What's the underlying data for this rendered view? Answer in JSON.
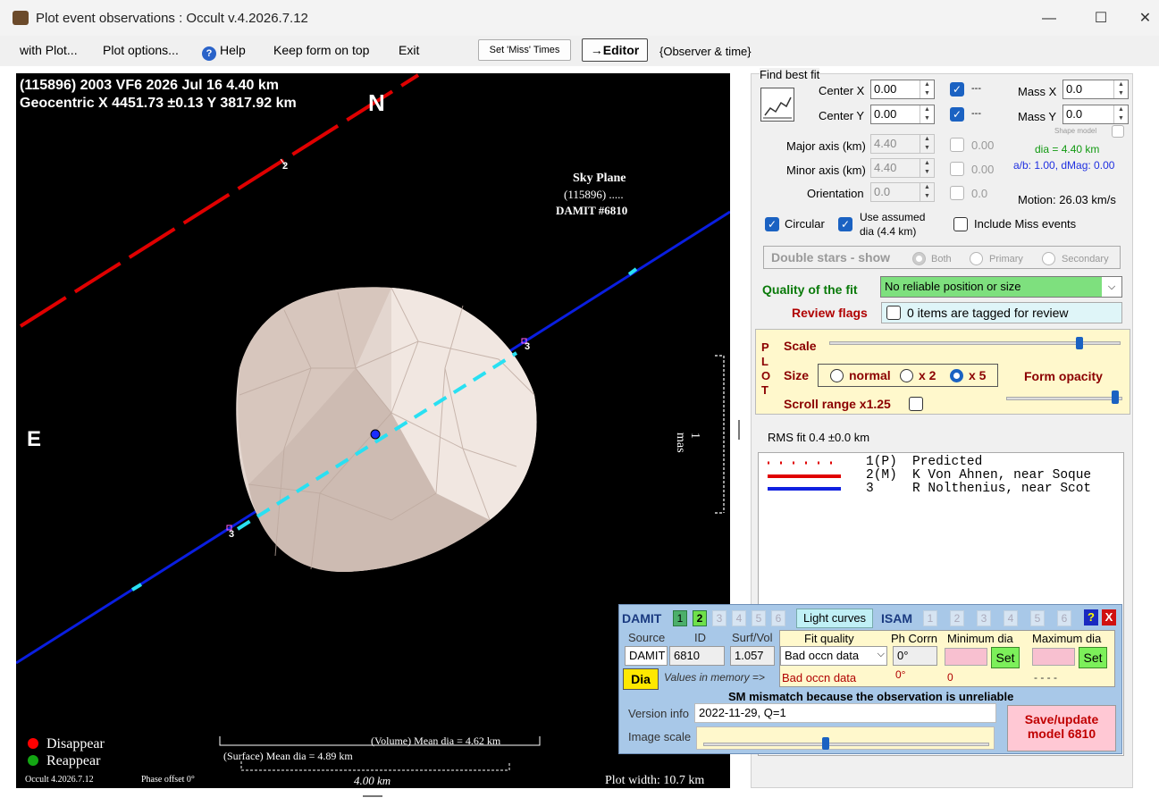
{
  "window": {
    "title": "Plot event observations : Occult v.4.2026.7.12",
    "minimize": "—",
    "maximize": "☐",
    "close": "✕"
  },
  "menu": {
    "with_plot": "with Plot...",
    "plot_options": "Plot options...",
    "help": "Help",
    "keep_on_top": "Keep form on top",
    "exit": "Exit",
    "set_miss_times": "Set 'Miss' Times",
    "editor": "→Editor",
    "observer_time": "{Observer & time}"
  },
  "plot": {
    "header_line1": "(115896) 2003 VF6  2026 Jul 16   4.40 km",
    "header_line2": "Geocentric  X 4451.73 ±0.13  Y 3817.92 km",
    "north": "N",
    "east": "E",
    "sky_plane_1": "Sky Plane",
    "sky_plane_2": "(115896) .....",
    "sky_plane_3": "DAMIT #6810",
    "scale_label": "1 mas",
    "chord2_label": "2",
    "chord3a_label": "3",
    "chord3b_label": "3",
    "legend_disappear": "Disappear",
    "legend_reappear": "Reappear",
    "volume_dia": "(Volume) Mean dia = 4.62 km",
    "surface_dia": "(Surface) Mean dia = 4.89 km",
    "version": "Occult 4.2026.7.12",
    "phase_offset": "Phase offset 0°",
    "scale_bar": "4.00 km",
    "plot_width": "Plot width: 10.7 km"
  },
  "bestfit": {
    "group_title": "Find best fit",
    "center_x_label": "Center X",
    "center_x": "0.00",
    "center_y_label": "Center Y",
    "center_y": "0.00",
    "dash1": "---",
    "dash2": "---",
    "mass_x_label": "Mass X",
    "mass_x": "0.0",
    "mass_y_label": "Mass Y",
    "mass_y": "0.0",
    "shape_model": "Shape model",
    "major_label": "Major axis (km)",
    "major": "4.40",
    "major_chk": "0.00",
    "minor_label": "Minor axis (km)",
    "minor": "4.40",
    "minor_chk": "0.00",
    "orient_label": "Orientation",
    "orient": "0.0",
    "orient_chk": "0.0",
    "dia": "dia = 4.40 km",
    "ab": "a/b: 1.00, dMag: 0.00",
    "motion": "Motion: 26.03 km/s",
    "circular": "Circular",
    "use_assumed_1": "Use assumed",
    "use_assumed_2": "dia (4.4 km)",
    "include_miss": "Include Miss events",
    "double_stars": "Double stars - show",
    "both": "Both",
    "primary": "Primary",
    "secondary": "Secondary",
    "quality_label": "Quality of the fit",
    "quality_value": "No reliable position or size",
    "review_label": "Review flags",
    "review_value": "0 items are tagged for review"
  },
  "plotctrl": {
    "side_label": "P L O T",
    "scale": "Scale",
    "size": "Size",
    "normal": "normal",
    "x2": "x 2",
    "x5": "x 5",
    "form_opacity": "Form opacity",
    "scroll_range": "Scroll range x1.25"
  },
  "rms": "RMS fit 0.4 ±0.0 km",
  "legend": {
    "rows": [
      {
        "id": "1(P)",
        "text": "Predicted"
      },
      {
        "id": "2(M)",
        "text": "K Von Ahnen, near Soque"
      },
      {
        "id": "3",
        "text": "R Nolthenius, near Scot"
      }
    ]
  },
  "damit": {
    "title": "DAMIT",
    "nums": [
      "1",
      "2",
      "3",
      "4",
      "5",
      "6"
    ],
    "light_curves": "Light curves",
    "isam": "ISAM",
    "isam_nums": [
      "1",
      "2",
      "3",
      "4",
      "5",
      "6"
    ],
    "help": "?",
    "close": "X",
    "h_source": "Source",
    "h_id": "ID",
    "h_surfvol": "Surf/Vol",
    "h_fitq": "Fit quality",
    "h_phcorr": "Ph Corrn",
    "h_mindia": "Minimum dia",
    "h_maxdia": "Maximum dia",
    "source": "DAMIT",
    "id": "6810",
    "surfvol": "1.057",
    "fitq": "Bad occn data",
    "phcorr": "0°",
    "set": "Set",
    "dia_btn": "Dia",
    "values_mem": "Values in memory =>",
    "mem_fitq": "Bad occn data",
    "mem_ph": "0°",
    "mem_min": "0",
    "mem_max": "- - - -",
    "mismatch": "SM mismatch because the observation is unreliable",
    "version_label": "Version info",
    "version_value": "2022-11-29, Q=1",
    "image_scale": "Image scale",
    "save_1": "Save/update",
    "save_2": "model 6810"
  }
}
